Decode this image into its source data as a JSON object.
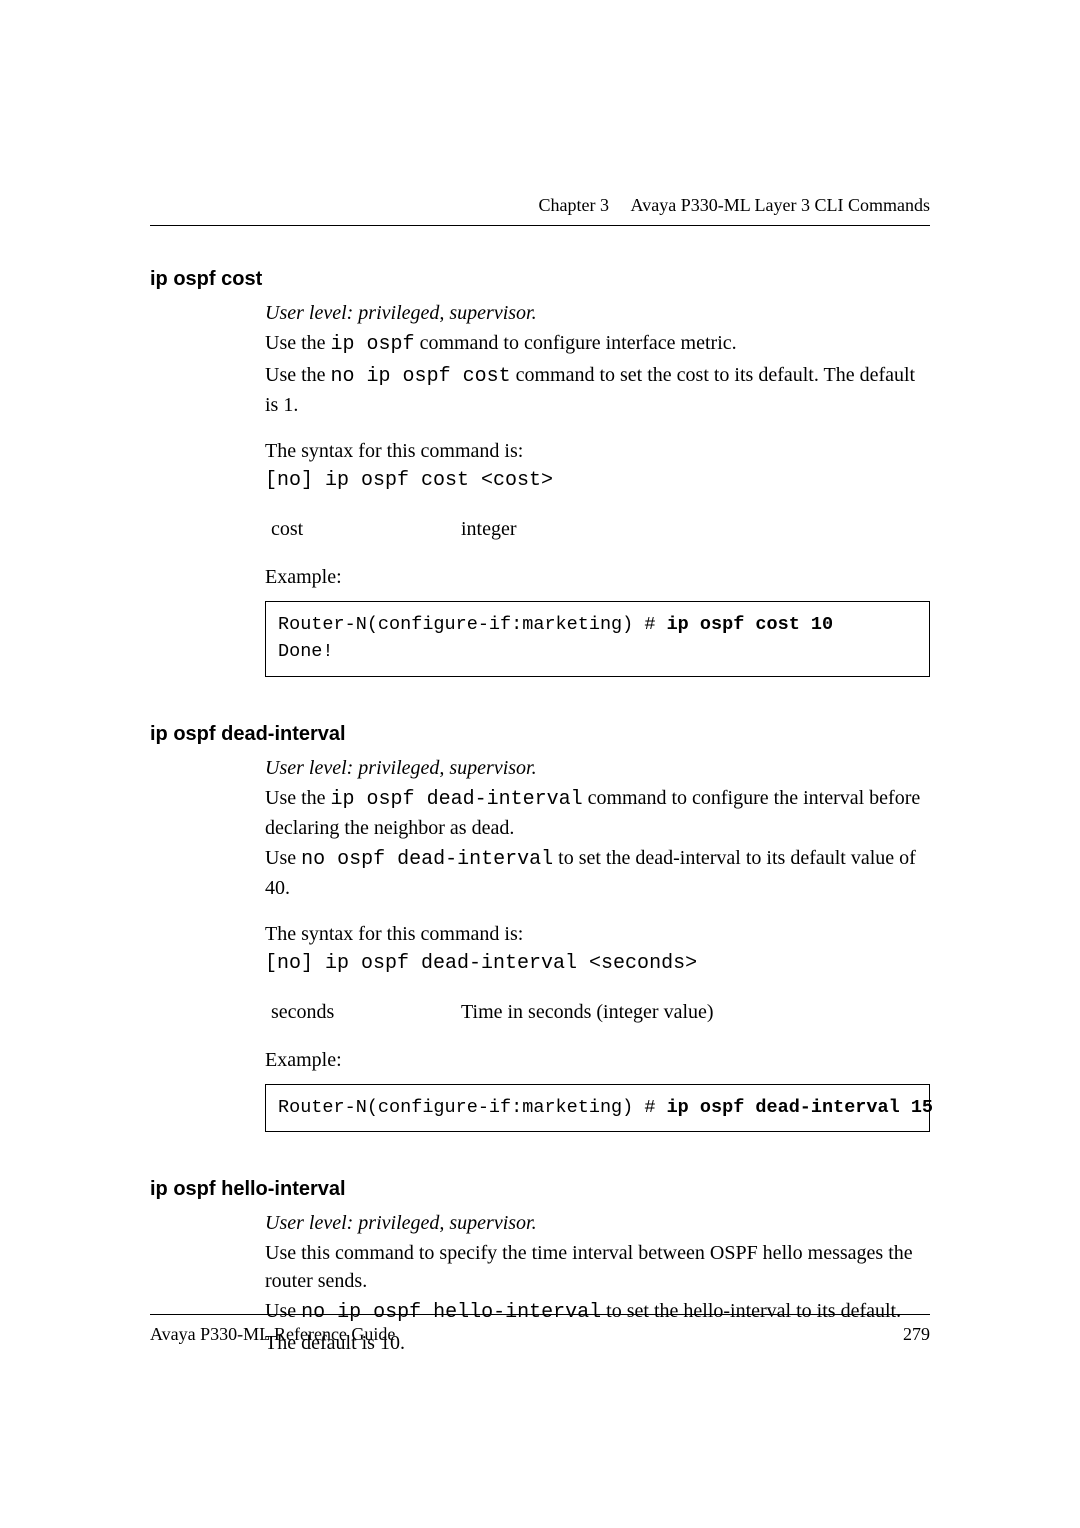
{
  "header": {
    "chapter": "Chapter 3",
    "title": "Avaya P330-ML Layer 3 CLI Commands"
  },
  "footer": {
    "left": "Avaya P330-ML Reference Guide",
    "page": "279"
  },
  "sections": {
    "cost": {
      "heading": "ip ospf cost",
      "userlevel": "User level: privileged, supervisor.",
      "p1_a": "Use the ",
      "p1_cmd": "ip ospf",
      "p1_b": " command to configure interface metric.",
      "p2_a": "Use the ",
      "p2_cmd": "no ip ospf cost",
      "p2_b": " command to set the cost to its default. The default is 1.",
      "syntax_label": "The syntax for this command is:",
      "syntax": "[no] ip ospf cost <cost>",
      "param_name": "cost",
      "param_desc": "integer",
      "example_label": "Example:",
      "example_prompt": "Router-N(configure-if:marketing) # ",
      "example_cmd": "ip ospf cost 10",
      "example_result": "Done!"
    },
    "dead": {
      "heading": "ip ospf dead-interval",
      "userlevel": "User level: privileged, supervisor.",
      "p1_a": "Use the ",
      "p1_cmd": "ip ospf dead-interval",
      "p1_b": " command to configure the interval before declaring the neighbor as dead.",
      "p2_a": "Use ",
      "p2_cmd": "no ospf dead-interval",
      "p2_b": " to set the dead-interval to its default value of 40.",
      "syntax_label": "The syntax for this command is:",
      "syntax": "[no] ip ospf dead-interval <seconds>",
      "param_name": "seconds",
      "param_desc": "Time in seconds (integer value)",
      "example_label": "Example:",
      "example_prompt": "Router-N(configure-if:marketing) # ",
      "example_cmd": "ip ospf dead-interval 15"
    },
    "hello": {
      "heading": "ip ospf hello-interval",
      "userlevel": "User level: privileged, supervisor.",
      "p1": "Use this command to specify the time interval between OSPF hello messages the router sends.",
      "p2_a": "Use ",
      "p2_cmd": "no ip ospf hello-interval",
      "p2_b": " to set the hello-interval to its default.",
      "p3": "The default is 10."
    }
  }
}
